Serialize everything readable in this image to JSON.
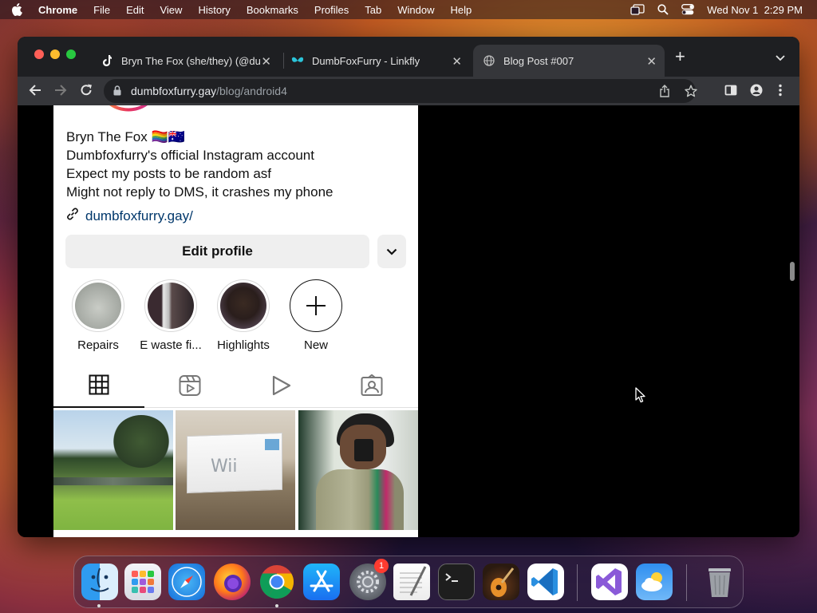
{
  "menubar": {
    "app_name": "Chrome",
    "items": [
      "File",
      "Edit",
      "View",
      "History",
      "Bookmarks",
      "Profiles",
      "Tab",
      "Window",
      "Help"
    ],
    "clock": "Wed Nov 1  2:29 PM"
  },
  "tabs": [
    {
      "title": "Bryn The Fox (she/they) (@du",
      "icon": "tiktok-icon"
    },
    {
      "title": "DumbFoxFurry - Linkfly",
      "icon": "linkfly-icon"
    },
    {
      "title": "Blog Post #007",
      "icon": "globe-icon"
    }
  ],
  "address_bar": {
    "domain": "dumbfoxfurry.gay",
    "path": "/blog/android4"
  },
  "profile": {
    "name": "Bryn The Fox 🏳️‍🌈🇦🇺",
    "bio": [
      "Dumbfoxfurry's official Instagram account",
      "Expect my posts to be random asf",
      "Might not reply to DMS, it crashes my phone"
    ],
    "link": "dumbfoxfurry.gay/",
    "edit_label": "Edit profile"
  },
  "highlights": [
    {
      "label": "Repairs"
    },
    {
      "label": "E waste fi..."
    },
    {
      "label": "Highlights"
    },
    {
      "label": "New"
    }
  ],
  "grid_tabs": [
    "grid-icon",
    "reels-icon",
    "video-icon",
    "tagged-icon"
  ],
  "photos": [
    {
      "subject": "park"
    },
    {
      "subject": "Wii"
    },
    {
      "subject": "selfie"
    }
  ],
  "wii_text": "Wii",
  "dock": {
    "apps": [
      "Finder",
      "Launchpad",
      "Safari",
      "Firefox",
      "Chrome",
      "App Store",
      "System Settings",
      "TextEdit",
      "Terminal",
      "GarageBand",
      "Visual Studio Code",
      "Visual Studio",
      "Weather",
      "Trash"
    ],
    "settings_badge": "1"
  }
}
